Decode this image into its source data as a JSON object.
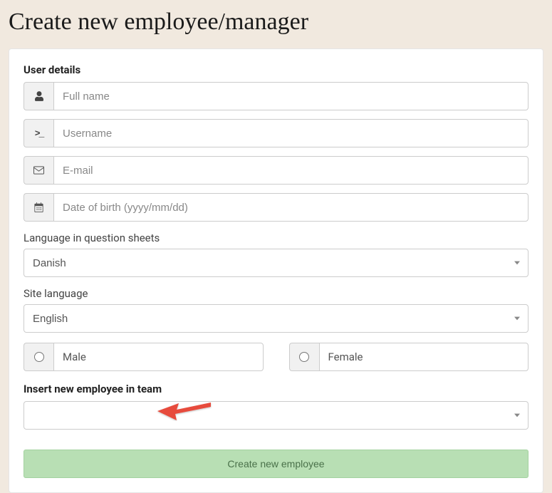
{
  "page": {
    "title": "Create new employee/manager"
  },
  "sections": {
    "user_details_heading": "User details",
    "insert_team_heading": "Insert new employee in team"
  },
  "fields": {
    "full_name": {
      "placeholder": "Full name",
      "value": ""
    },
    "username": {
      "placeholder": "Username",
      "value": ""
    },
    "email": {
      "placeholder": "E-mail",
      "value": ""
    },
    "dob": {
      "placeholder": "Date of birth (yyyy/mm/dd)",
      "value": ""
    }
  },
  "labels": {
    "language_sheets": "Language in question sheets",
    "site_language": "Site language"
  },
  "selects": {
    "language_sheets": {
      "selected": "Danish"
    },
    "site_language": {
      "selected": "English"
    },
    "team": {
      "selected": ""
    }
  },
  "gender": {
    "male_label": "Male",
    "female_label": "Female"
  },
  "actions": {
    "submit_label": "Create new employee"
  }
}
